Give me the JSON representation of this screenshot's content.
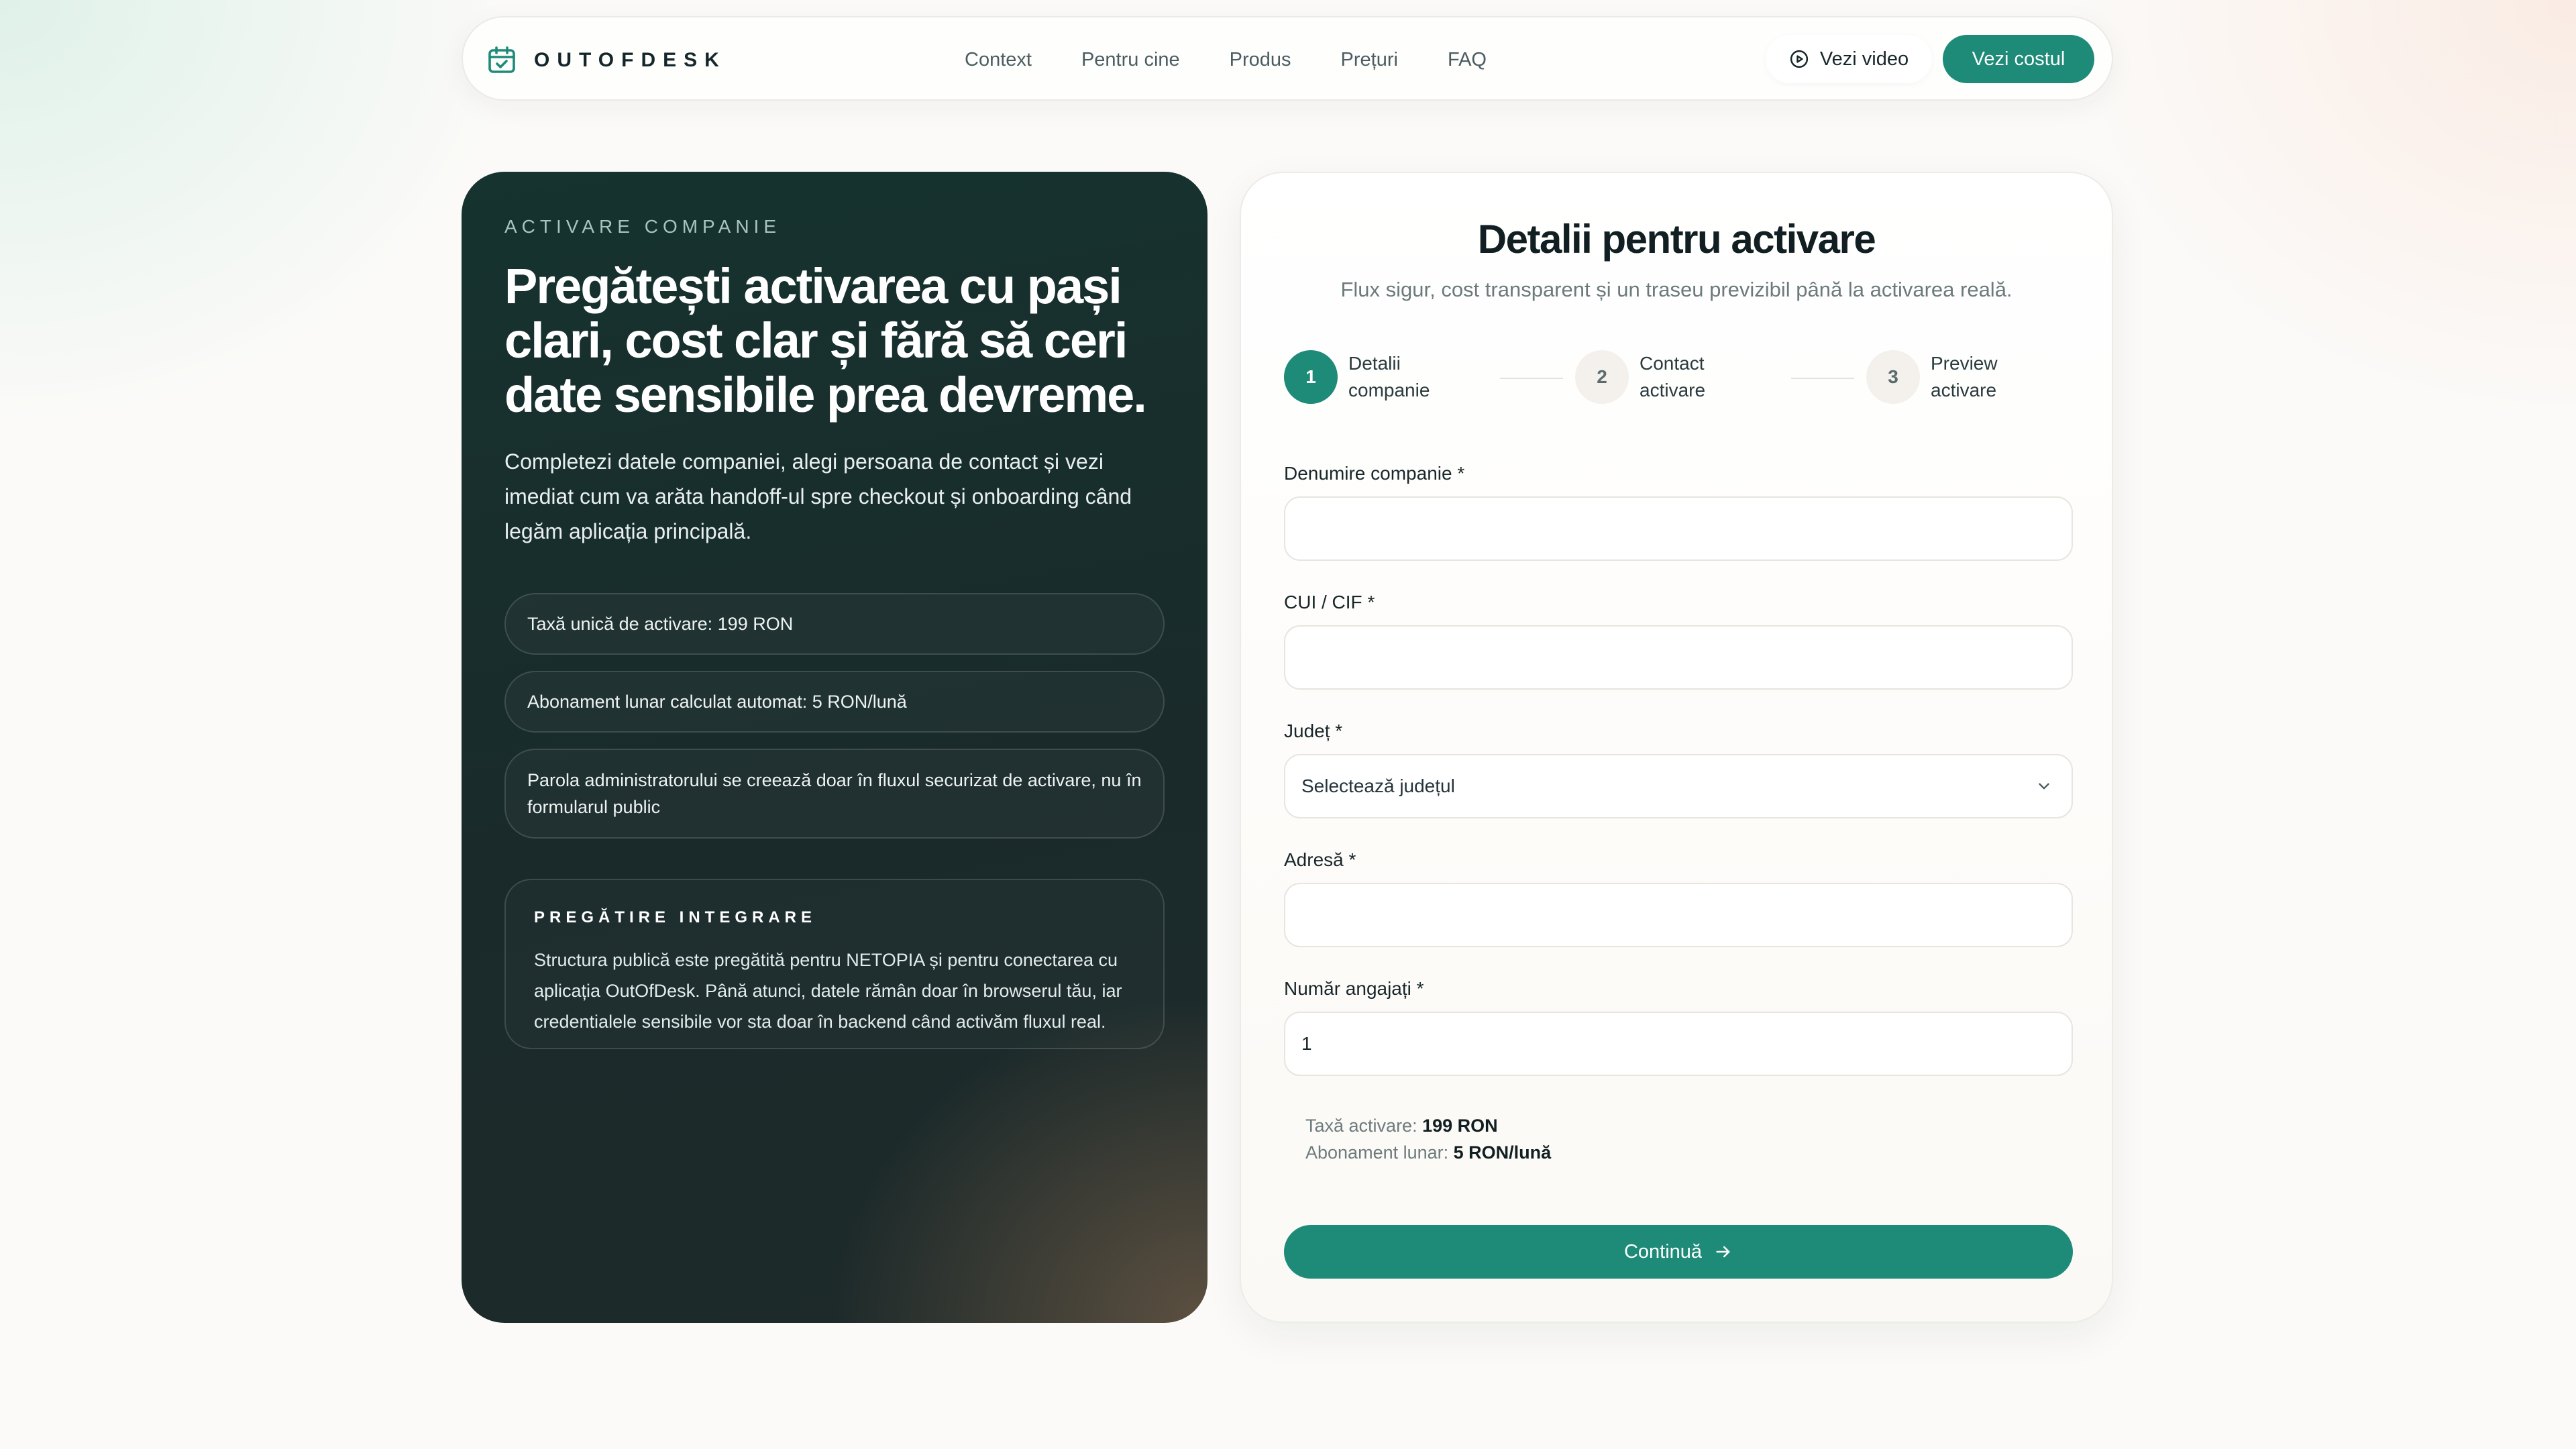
{
  "nav": {
    "brand": "OUTOFDESK",
    "links": [
      "Context",
      "Pentru cine",
      "Produs",
      "Prețuri",
      "FAQ"
    ],
    "video_button": "Vezi video",
    "cost_button": "Vezi costul"
  },
  "hero": {
    "eyebrow": "ACTIVARE COMPANIE",
    "title": "Pregătești activarea cu pași clari, cost clar și fără să ceri date sensibile prea devreme.",
    "description": "Completezi datele companiei, alegi persoana de contact și vezi imediat cum va arăta handoff-ul spre checkout și onboarding când legăm aplicația principală.",
    "pills": [
      "Taxă unică de activare: 199 RON",
      "Abonament lunar calculat automat: 5 RON/lună",
      "Parola administratorului se creează doar în fluxul securizat de activare, nu în formularul public"
    ],
    "integration": {
      "title": "PREGĂTIRE INTEGRARE",
      "text": "Structura publică este pregătită pentru NETOPIA și pentru conectarea cu aplicația OutOfDesk. Până atunci, datele rămân doar în browserul tău, iar credentialele sensibile vor sta doar în backend când activăm fluxul real."
    }
  },
  "form": {
    "title": "Detalii pentru activare",
    "subtitle": "Flux sigur, cost transparent și un traseu previzibil până la activarea reală.",
    "steps": [
      {
        "number": "1",
        "label": "Detalii companie",
        "active": true
      },
      {
        "number": "2",
        "label": "Contact activare",
        "active": false
      },
      {
        "number": "3",
        "label": "Preview activare",
        "active": false
      }
    ],
    "fields": {
      "company_name": {
        "label": "Denumire companie *",
        "value": ""
      },
      "cui": {
        "label": "CUI / CIF *",
        "value": ""
      },
      "county": {
        "label": "Județ *",
        "value": "Selectează județul"
      },
      "address": {
        "label": "Adresă *",
        "value": ""
      },
      "employees": {
        "label": "Număr angajați *",
        "value": "1"
      }
    },
    "summary": {
      "activation_label": "Taxă activare:",
      "activation_value": "199 RON",
      "monthly_label": "Abonament lunar:",
      "monthly_value": "5 RON/lună"
    },
    "continue_button": "Continuă"
  },
  "colors": {
    "accent": "#1e8a78",
    "dark_panel": "#17302e",
    "page_background": "#fbfaf8"
  }
}
